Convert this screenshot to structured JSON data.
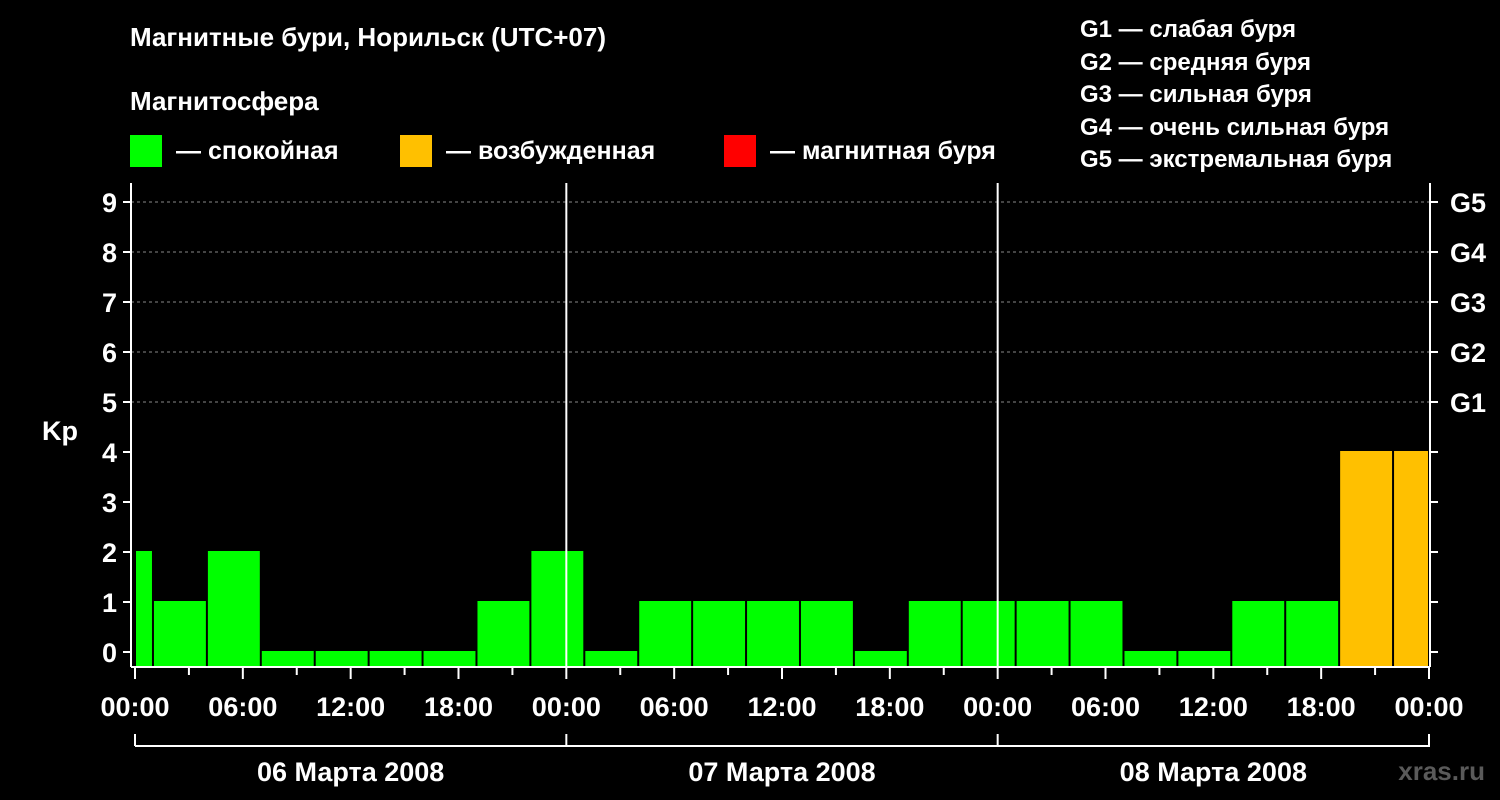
{
  "header": {
    "title": "Магнитные бури, Норильск (UTC+07)",
    "subtitle": "Магнитосфера"
  },
  "legend": [
    {
      "label": "— спокойная",
      "color": "#00ff00"
    },
    {
      "label": "— возбужденная",
      "color": "#ffc000"
    },
    {
      "label": "— магнитная буря",
      "color": "#ff0000"
    }
  ],
  "g_legend": [
    "G1 — слабая буря",
    "G2 — средняя буря",
    "G3 — сильная буря",
    "G4 — очень сильная буря",
    "G5 — экстремальная буря"
  ],
  "watermark": "xras.ru",
  "chart_data": {
    "type": "bar",
    "title": "Магнитные бури, Норильск (UTC+07)",
    "ylabel": "Kp",
    "ylim": [
      0,
      9
    ],
    "yticks": [
      "0",
      "1",
      "2",
      "3",
      "4",
      "5",
      "6",
      "7",
      "8",
      "9"
    ],
    "right_ticks": [
      {
        "kp": 5,
        "label": "G1"
      },
      {
        "kp": 6,
        "label": "G2"
      },
      {
        "kp": 7,
        "label": "G3"
      },
      {
        "kp": 8,
        "label": "G4"
      },
      {
        "kp": 9,
        "label": "G5"
      }
    ],
    "xticks": [
      "00:00",
      "06:00",
      "12:00",
      "18:00",
      "00:00",
      "06:00",
      "12:00",
      "18:00",
      "00:00",
      "06:00",
      "12:00",
      "18:00",
      "00:00"
    ],
    "days": [
      "06 Марта 2008",
      "07 Марта 2008",
      "08 Марта 2008"
    ],
    "grid_dashed_at_kp": [
      5,
      6,
      7,
      8,
      9
    ],
    "colors": {
      "quiet": "#00ff00",
      "active": "#ffc000",
      "storm": "#ff0000"
    },
    "bars": [
      {
        "start_hour": 0,
        "end_hour": 1,
        "kp": 2,
        "status": "quiet"
      },
      {
        "start_hour": 1,
        "end_hour": 4,
        "kp": 1,
        "status": "quiet"
      },
      {
        "start_hour": 4,
        "end_hour": 7,
        "kp": 2,
        "status": "quiet"
      },
      {
        "start_hour": 7,
        "end_hour": 10,
        "kp": 0,
        "status": "quiet"
      },
      {
        "start_hour": 10,
        "end_hour": 13,
        "kp": 0,
        "status": "quiet"
      },
      {
        "start_hour": 13,
        "end_hour": 16,
        "kp": 0,
        "status": "quiet"
      },
      {
        "start_hour": 16,
        "end_hour": 19,
        "kp": 0,
        "status": "quiet"
      },
      {
        "start_hour": 19,
        "end_hour": 22,
        "kp": 1,
        "status": "quiet"
      },
      {
        "start_hour": 22,
        "end_hour": 25,
        "kp": 2,
        "status": "quiet"
      },
      {
        "start_hour": 25,
        "end_hour": 28,
        "kp": 0,
        "status": "quiet"
      },
      {
        "start_hour": 28,
        "end_hour": 31,
        "kp": 1,
        "status": "quiet"
      },
      {
        "start_hour": 31,
        "end_hour": 34,
        "kp": 1,
        "status": "quiet"
      },
      {
        "start_hour": 34,
        "end_hour": 37,
        "kp": 1,
        "status": "quiet"
      },
      {
        "start_hour": 37,
        "end_hour": 40,
        "kp": 1,
        "status": "quiet"
      },
      {
        "start_hour": 40,
        "end_hour": 43,
        "kp": 0,
        "status": "quiet"
      },
      {
        "start_hour": 43,
        "end_hour": 46,
        "kp": 1,
        "status": "quiet"
      },
      {
        "start_hour": 46,
        "end_hour": 49,
        "kp": 1,
        "status": "quiet"
      },
      {
        "start_hour": 49,
        "end_hour": 52,
        "kp": 1,
        "status": "quiet"
      },
      {
        "start_hour": 52,
        "end_hour": 55,
        "kp": 1,
        "status": "quiet"
      },
      {
        "start_hour": 55,
        "end_hour": 58,
        "kp": 0,
        "status": "quiet"
      },
      {
        "start_hour": 58,
        "end_hour": 61,
        "kp": 0,
        "status": "quiet"
      },
      {
        "start_hour": 61,
        "end_hour": 64,
        "kp": 1,
        "status": "quiet"
      },
      {
        "start_hour": 64,
        "end_hour": 67,
        "kp": 1,
        "status": "quiet"
      },
      {
        "start_hour": 67,
        "end_hour": 70,
        "kp": 4,
        "status": "active"
      },
      {
        "start_hour": 70,
        "end_hour": 72,
        "kp": 4,
        "status": "active"
      }
    ]
  }
}
